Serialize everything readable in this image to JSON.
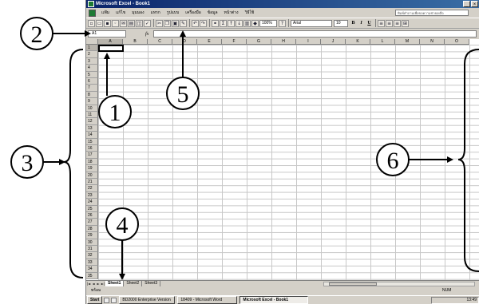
{
  "window": {
    "title": "Microsoft Excel - Book1",
    "controls": [
      "_",
      "×"
    ]
  },
  "menu": {
    "items": [
      "แฟ้ม",
      "แก้ไข",
      "มุมมอง",
      "แทรก",
      "รูปแบบ",
      "เครื่องมือ",
      "ข้อมูล",
      "หน้าต่าง",
      "วิธีใช้"
    ],
    "help_box": "พิมพ์คำถามเพื่อขอความช่วยเหลือ"
  },
  "toolbar": {
    "zoom": "100%",
    "font_name": "Arial",
    "font_size": "10",
    "bold": "B",
    "italic": "I",
    "underline": "U"
  },
  "formula_bar": {
    "name_box": "A1",
    "fx_label": "fx"
  },
  "grid": {
    "columns": [
      "A",
      "B",
      "C",
      "D",
      "E",
      "F",
      "G",
      "H",
      "I",
      "J",
      "K",
      "L",
      "M",
      "N",
      "O"
    ],
    "rows": [
      "1",
      "2",
      "3",
      "4",
      "5",
      "6",
      "7",
      "8",
      "9",
      "10",
      "11",
      "12",
      "13",
      "14",
      "15",
      "16",
      "17",
      "18",
      "19",
      "20",
      "21",
      "22",
      "23",
      "24",
      "25",
      "26",
      "27",
      "28",
      "29",
      "30",
      "31",
      "32",
      "33",
      "34",
      "35"
    ],
    "active_cell": "A1"
  },
  "sheets": {
    "tabs": [
      "Sheet1",
      "Sheet2",
      "Sheet3"
    ],
    "active": "Sheet1",
    "nav": [
      "|◄",
      "◄",
      "►",
      "►|"
    ]
  },
  "status": {
    "ready": "พร้อม",
    "num": "NUM"
  },
  "taskbar": {
    "start": "Start",
    "tasks": [
      "BD2000 Enterprise Version",
      "18409 - Microsoft Word",
      "Microsoft Excel - Book1"
    ],
    "active_task": "Microsoft Excel - Book1",
    "clock": "13:49"
  },
  "callouts": {
    "labels": [
      "1",
      "2",
      "3",
      "4",
      "5",
      "6"
    ]
  }
}
